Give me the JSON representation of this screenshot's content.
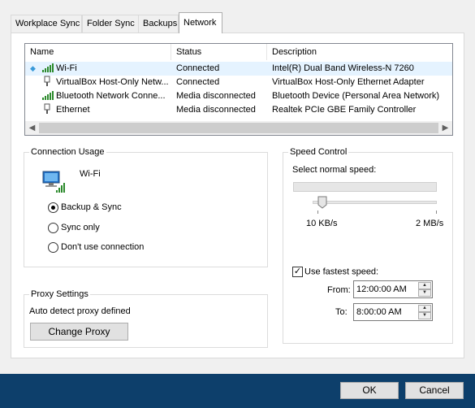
{
  "tabs": [
    {
      "label": "Workplace Sync",
      "active": false
    },
    {
      "label": "Folder Sync",
      "active": false
    },
    {
      "label": "Backups",
      "active": false
    },
    {
      "label": "Network",
      "active": true
    }
  ],
  "network_list": {
    "columns": [
      "Name",
      "Status",
      "Description"
    ],
    "rows": [
      {
        "name": "Wi-Fi",
        "status": "Connected",
        "description": "Intel(R) Dual Band Wireless-N 7260",
        "icon": "wifi-signal-icon",
        "selected": true
      },
      {
        "name": "VirtualBox Host-Only Netw...",
        "status": "Connected",
        "description": "VirtualBox Host-Only Ethernet Adapter",
        "icon": "ethernet-plug-icon",
        "selected": false
      },
      {
        "name": "Bluetooth Network Conne...",
        "status": "Media disconnected",
        "description": "Bluetooth Device (Personal Area Network)",
        "icon": "wifi-signal-icon",
        "selected": false
      },
      {
        "name": "Ethernet",
        "status": "Media disconnected",
        "description": "Realtek PCIe GBE Family Controller",
        "icon": "ethernet-plug-icon",
        "selected": false
      }
    ]
  },
  "connection_usage": {
    "title": "Connection Usage",
    "network_name": "Wi-Fi",
    "options": [
      {
        "label": "Backup & Sync",
        "selected": true
      },
      {
        "label": "Sync only",
        "selected": false
      },
      {
        "label": "Don't use connection",
        "selected": false
      }
    ]
  },
  "speed_control": {
    "title": "Speed Control",
    "select_label": "Select normal speed:",
    "min_label": "10 KB/s",
    "max_label": "2 MB/s",
    "slider_level": 0.08,
    "fastest_label": "Use fastest speed:",
    "fastest_checked": true,
    "from_label": "From:",
    "from_value": "12:00:00 AM",
    "to_label": "To:",
    "to_value": "8:00:00 AM"
  },
  "proxy": {
    "title": "Proxy Settings",
    "status": "Auto detect proxy defined",
    "button": "Change Proxy"
  },
  "dialog": {
    "ok": "OK",
    "cancel": "Cancel"
  },
  "colors": {
    "bottom_bar": "#0d3f6b",
    "selected_row": "#e5f3ff"
  }
}
